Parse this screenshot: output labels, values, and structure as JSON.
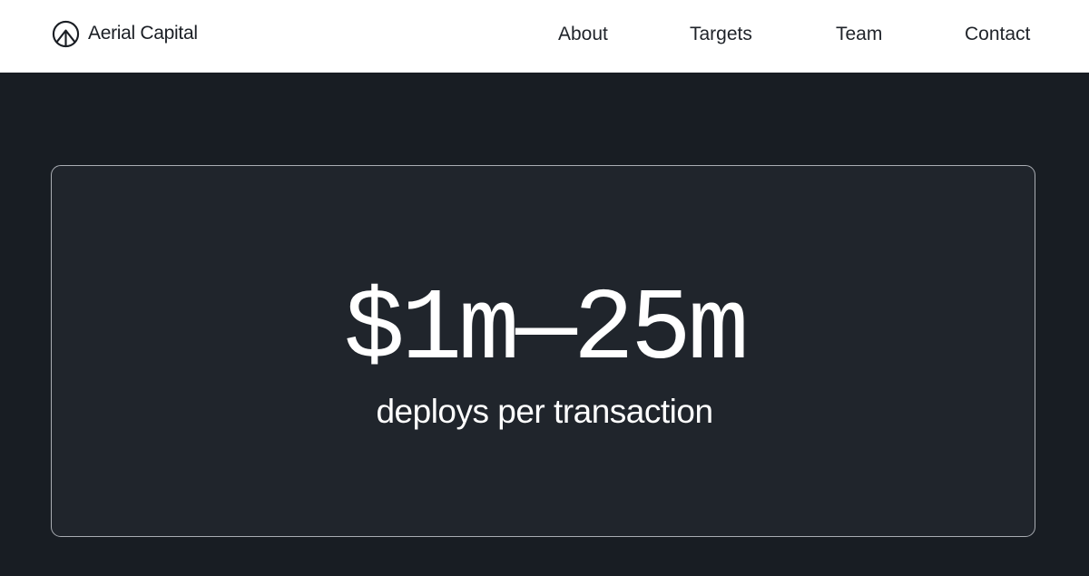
{
  "header": {
    "brand": {
      "name": "Aerial Capital",
      "icon": "mountain-circle-logo-icon"
    },
    "nav": [
      {
        "label": "About"
      },
      {
        "label": "Targets"
      },
      {
        "label": "Team"
      },
      {
        "label": "Contact"
      }
    ]
  },
  "hero": {
    "stat_value": "$1m—25m",
    "stat_caption": "deploys per transaction"
  },
  "colors": {
    "header_bg": "#ffffff",
    "page_bg": "#181d23",
    "card_bg": "#20252c",
    "card_border": "#a9adb3",
    "text_dark": "#1a1e24",
    "text_light": "#ffffff"
  }
}
